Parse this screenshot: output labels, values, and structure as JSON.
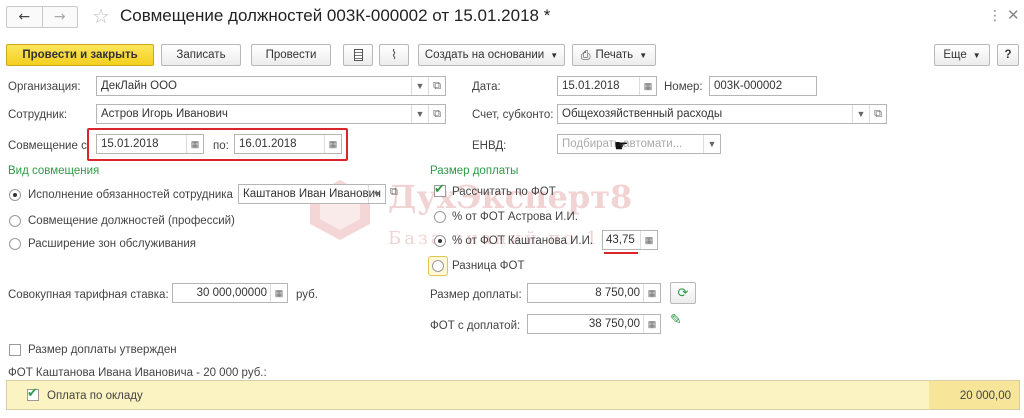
{
  "window": {
    "title": "Совмещение должностей 003К-000002 от 15.01.2018 *"
  },
  "toolbar": {
    "post_close": "Провести и закрыть",
    "write": "Записать",
    "post": "Провести",
    "create_based": "Создать на основании",
    "print": "Печать",
    "more": "Еще",
    "help": "?"
  },
  "form": {
    "org_label": "Организация:",
    "org_value": "ДекЛайн ООО",
    "date_label": "Дата:",
    "date_value": "15.01.2018",
    "number_label": "Номер:",
    "number_value": "003К-000002",
    "employee_label": "Сотрудник:",
    "employee_value": "Астров Игорь Иванович",
    "account_label": "Счет, субконто:",
    "account_value": "Общехозяйственный расходы",
    "combine_from_label": "Совмещение с",
    "combine_from_value": "15.01.2018",
    "combine_to_label": "по:",
    "combine_to_value": "16.01.2018",
    "envd_label": "ЕНВД:",
    "envd_placeholder": "Подбирать автомати..."
  },
  "combination_type": {
    "title": "Вид совмещения",
    "options": [
      "Исполнение обязанностей сотрудника",
      "Совмещение должностей (профессий)",
      "Расширение зон обслуживания"
    ],
    "selected_index": 0,
    "employee_value": "Каштанов Иван Иванович"
  },
  "surcharge": {
    "title": "Размер доплаты",
    "calc_by_fot_label": "Рассчитать по ФОТ",
    "calc_by_fot_checked": true,
    "options": [
      "% от ФОТ Астрова И.И.",
      "% от ФОТ Каштанова И.И.",
      "Разница ФОТ"
    ],
    "selected_index": 1,
    "percent_value": "43,75",
    "amount_label": "Размер доплаты:",
    "amount_value": "8 750,00",
    "fot_label": "ФОТ с доплатой:",
    "fot_value": "38 750,00"
  },
  "tariff": {
    "label": "Совокупная тарифная ставка:",
    "value": "30 000,00000",
    "unit": "руб."
  },
  "approved": {
    "label": "Размер доплаты утвержден",
    "checked": false
  },
  "fot_section": {
    "caption": "ФОТ Каштанова Ивана Ивановича - 20 000 руб.:",
    "rows": [
      {
        "name": "Оплата по окладу",
        "amount": "20 000,00",
        "checked": true
      }
    ]
  },
  "watermark": {
    "line1": "ДухЭксперт8",
    "line2": "База знаний по 1С"
  },
  "colors": {
    "accent_green": "#2e9a45",
    "primary_button": "#f3cf1e",
    "highlight_red": "#d9262c",
    "row_highlight": "#fcf3c2"
  }
}
